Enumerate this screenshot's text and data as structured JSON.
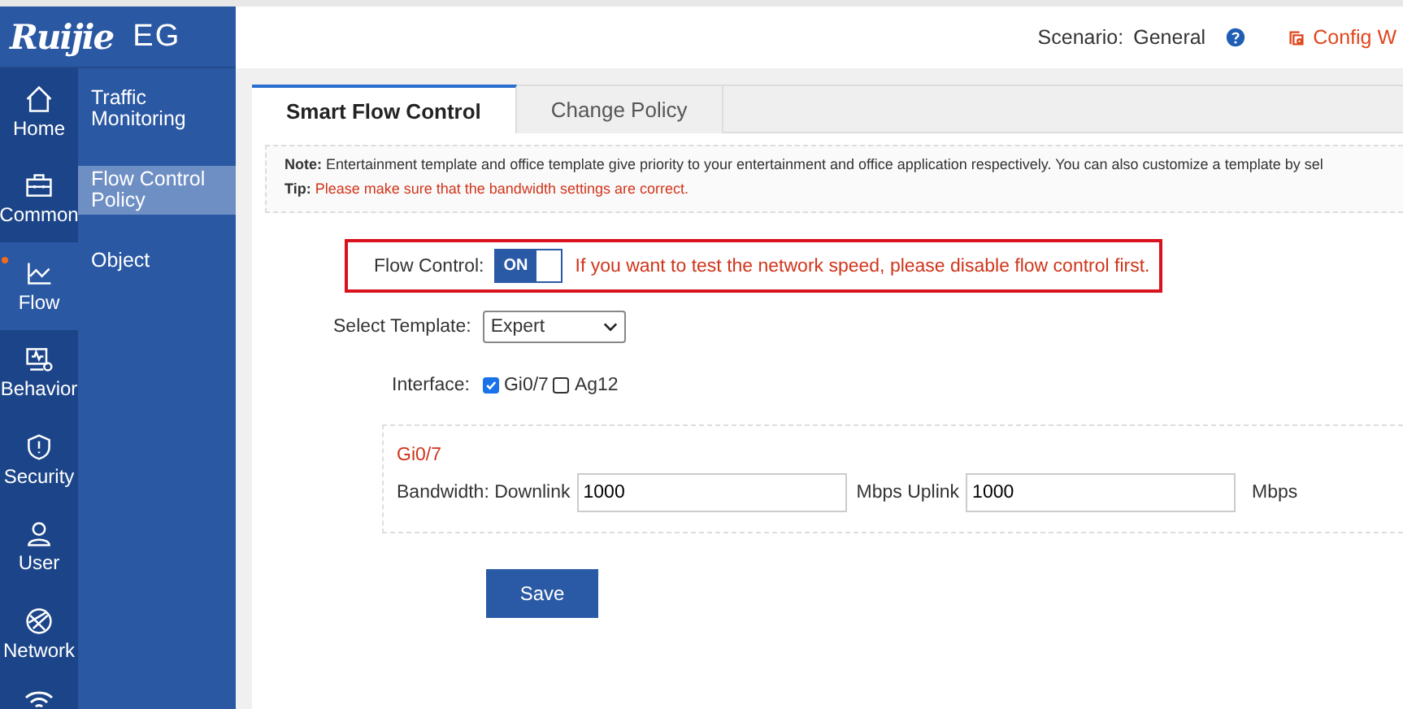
{
  "logo": {
    "brand": "Ruijie",
    "product": "EG"
  },
  "nav": [
    {
      "label": "Home",
      "kind": "home",
      "selected": false
    },
    {
      "label": "Common",
      "kind": "common",
      "selected": false
    },
    {
      "label": "Flow",
      "kind": "flow",
      "selected": true,
      "dot": true
    },
    {
      "label": "Behavior",
      "kind": "behavior",
      "selected": false
    },
    {
      "label": "Security",
      "kind": "security",
      "selected": false
    },
    {
      "label": "User",
      "kind": "user",
      "selected": false
    },
    {
      "label": "Network",
      "kind": "network",
      "selected": false
    }
  ],
  "submenu": [
    {
      "label": "Traffic Monitoring",
      "selected": false
    },
    {
      "label": "Flow Control Policy",
      "selected": true
    },
    {
      "label": "Object",
      "selected": false
    }
  ],
  "header": {
    "scenario_label": "Scenario:",
    "scenario_value": "General",
    "config_link": "Config W"
  },
  "tabs": [
    {
      "label": "Smart Flow Control",
      "selected": true
    },
    {
      "label": "Change Policy",
      "selected": false
    }
  ],
  "note": {
    "label": "Note:",
    "text": "Entertainment template and office template give priority to your entertainment and office application respectively. You can also customize a template by sel"
  },
  "tip": {
    "label": "Tip:",
    "text": "Please make sure that the bandwidth settings are correct."
  },
  "flow_control": {
    "label": "Flow Control:",
    "on": true,
    "toggle_text": "ON",
    "warning": "If you want to test the network speed, please disable flow control first."
  },
  "template": {
    "label": "Select Template:",
    "value": "Expert"
  },
  "interface": {
    "label": "Interface:",
    "options": [
      {
        "label": "Gi0/7",
        "checked": true
      },
      {
        "label": "Ag12",
        "checked": false
      }
    ]
  },
  "bandwidth": {
    "title": "Gi0/7",
    "label": "Bandwidth: Downlink",
    "downlink": "1000",
    "mid_label": "Mbps Uplink",
    "uplink": "1000",
    "unit": "Mbps"
  },
  "save_button": "Save"
}
